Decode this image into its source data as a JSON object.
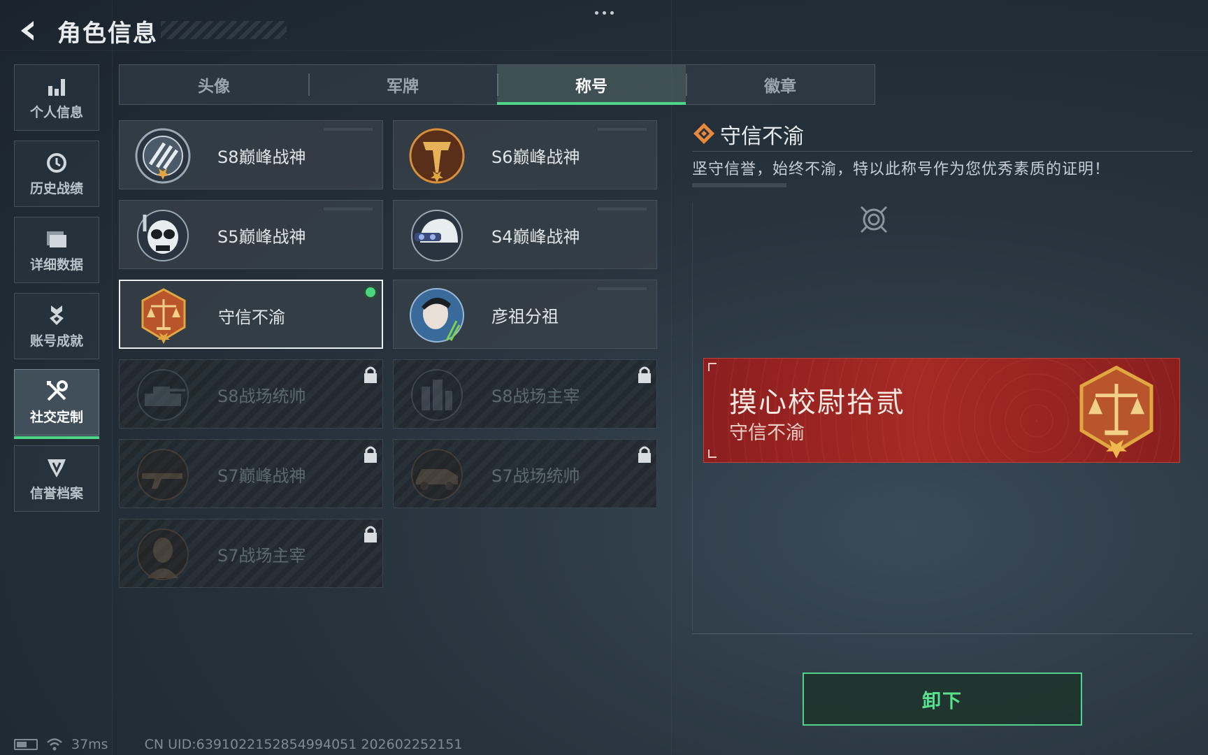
{
  "header": {
    "title": "角色信息",
    "back_icon": "back-arrow-icon",
    "menu_icon": "more-dots-icon"
  },
  "sidebar": {
    "items": [
      {
        "label": "个人信息",
        "icon": "bar-chart-icon",
        "active": false
      },
      {
        "label": "历史战绩",
        "icon": "history-clock-icon",
        "active": false
      },
      {
        "label": "详细数据",
        "icon": "folder-icon",
        "active": false
      },
      {
        "label": "账号成就",
        "icon": "achievement-medal-icon",
        "active": false
      },
      {
        "label": "社交定制",
        "icon": "tools-wrench-icon",
        "active": true
      },
      {
        "label": "信誉档案",
        "icon": "shield-v-icon",
        "active": false
      }
    ]
  },
  "tabs": [
    {
      "label": "头像",
      "active": false
    },
    {
      "label": "军牌",
      "active": false
    },
    {
      "label": "称号",
      "active": true
    },
    {
      "label": "徽章",
      "active": false
    }
  ],
  "titles": [
    {
      "name": "S8巅峰战神",
      "emblem": "stripes-shield-emblem",
      "locked": false,
      "selected": false
    },
    {
      "name": "S6巅峰战神",
      "emblem": "gold-t-shield-emblem",
      "locked": false,
      "selected": false
    },
    {
      "name": "S5巅峰战神",
      "emblem": "skull-snorkel-emblem",
      "locked": false,
      "selected": false
    },
    {
      "name": "S4巅峰战神",
      "emblem": "helmet-goggles-emblem",
      "locked": false,
      "selected": false
    },
    {
      "name": "守信不渝",
      "emblem": "scales-badge-emblem",
      "locked": false,
      "selected": true
    },
    {
      "name": "彦祖分祖",
      "emblem": "portrait-emblem",
      "locked": false,
      "selected": false
    },
    {
      "name": "S8战场统帅",
      "emblem": "tank-emblem",
      "locked": true,
      "selected": false
    },
    {
      "name": "S8战场主宰",
      "emblem": "city-emblem",
      "locked": true,
      "selected": false
    },
    {
      "name": "S7巅峰战神",
      "emblem": "rifle-emblem",
      "locked": true,
      "selected": false
    },
    {
      "name": "S7战场统帅",
      "emblem": "vehicle-emblem",
      "locked": true,
      "selected": false
    },
    {
      "name": "S7战场主宰",
      "emblem": "soldier-emblem",
      "locked": true,
      "selected": false
    }
  ],
  "detail": {
    "title": "守信不渝",
    "description": "坚守信誉，始终不渝，特以此称号作为您优秀素质的证明！",
    "banner": {
      "player_name": "摸心校尉拾贰",
      "title": "守信不渝"
    },
    "unequip_label": "卸下"
  },
  "status_bar": {
    "ping": "37ms",
    "uid": "CN UID:6391022152854994051 202602252151"
  },
  "colors": {
    "accent": "#4fd58a",
    "banner": "#a52a25",
    "emblem_gold": "#d8903a"
  }
}
